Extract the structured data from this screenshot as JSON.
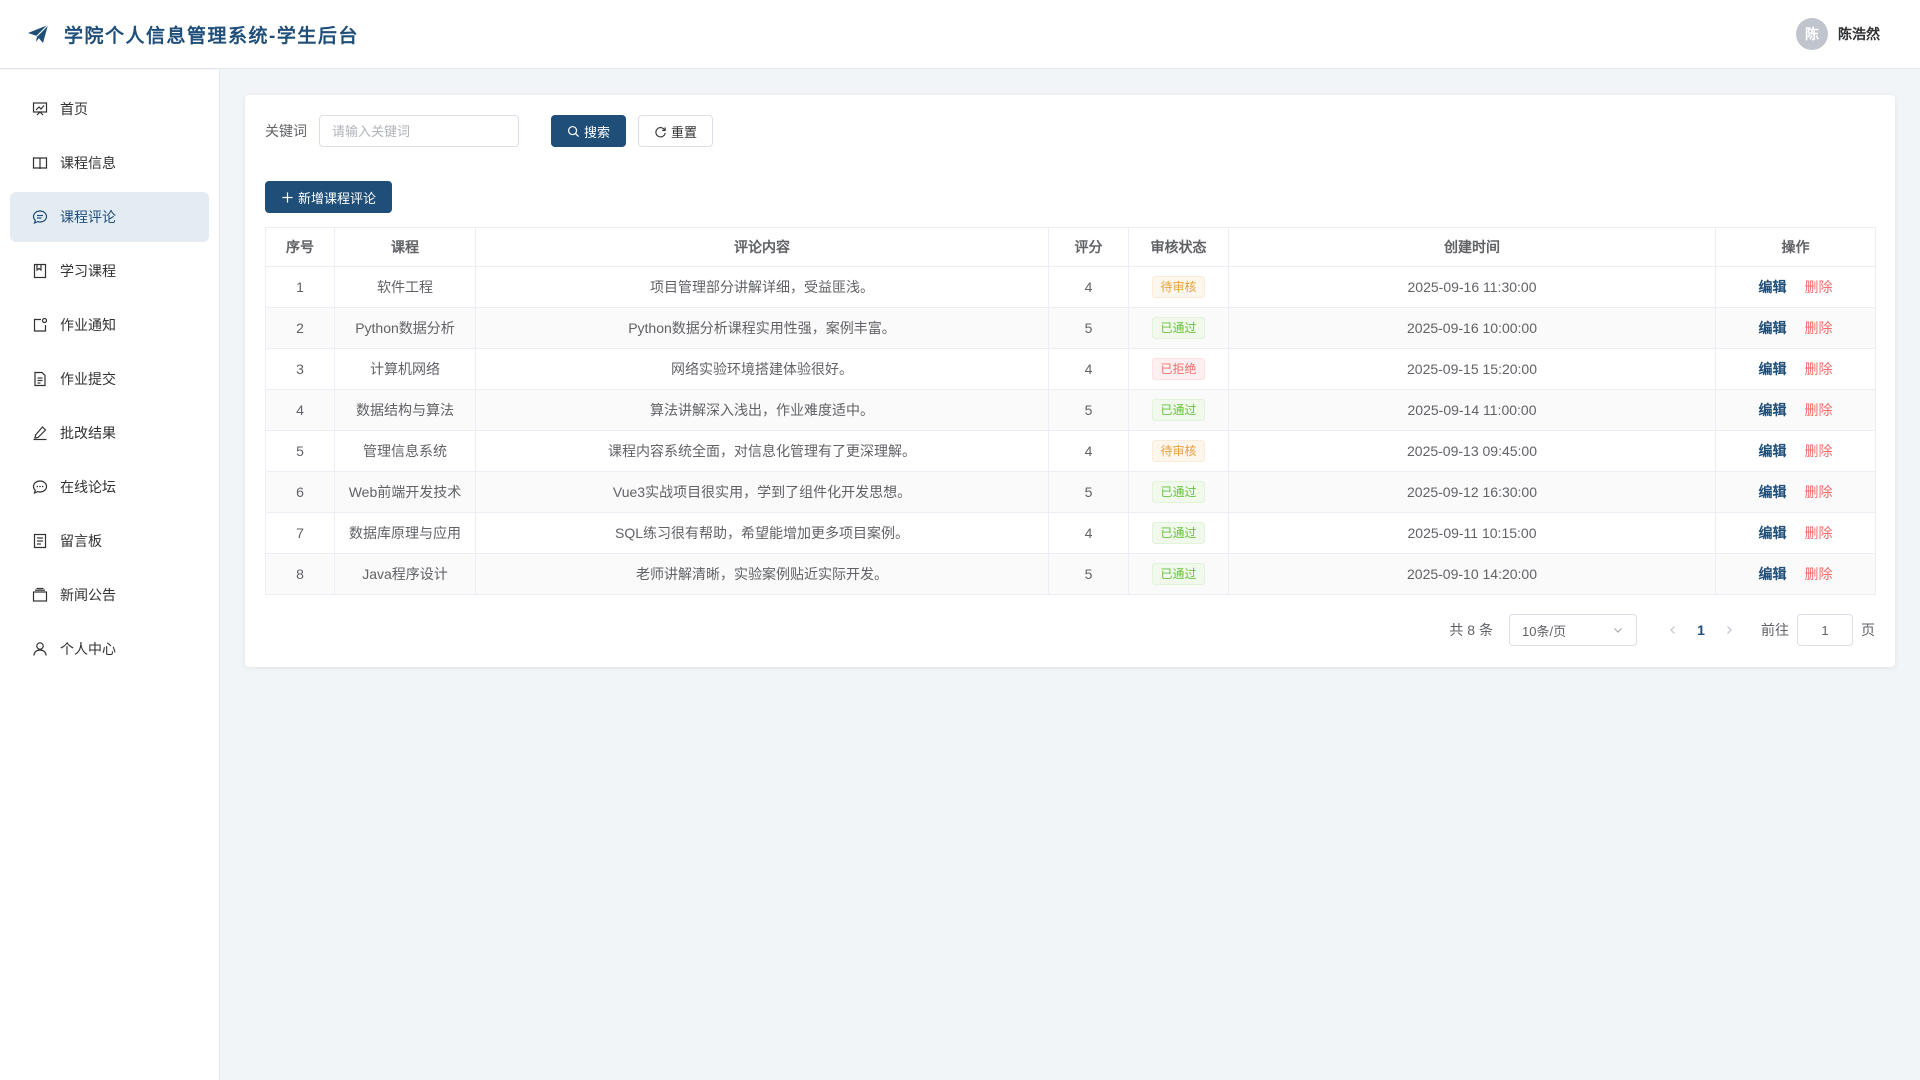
{
  "app": {
    "title": "学院个人信息管理系统-学生后台",
    "brand_color": "#1f4e79"
  },
  "user": {
    "avatar_text": "陈",
    "name": "陈浩然"
  },
  "sidebar": {
    "items": [
      {
        "label": "首页",
        "icon": "dashboard-icon"
      },
      {
        "label": "课程信息",
        "icon": "book-icon"
      },
      {
        "label": "课程评论",
        "icon": "comment-icon",
        "active": true
      },
      {
        "label": "学习课程",
        "icon": "bookmark-icon"
      },
      {
        "label": "作业通知",
        "icon": "notification-icon"
      },
      {
        "label": "作业提交",
        "icon": "document-icon"
      },
      {
        "label": "批改结果",
        "icon": "edit-pen-icon"
      },
      {
        "label": "在线论坛",
        "icon": "chat-icon"
      },
      {
        "label": "留言板",
        "icon": "tickets-icon"
      },
      {
        "label": "新闻公告",
        "icon": "news-box-icon"
      },
      {
        "label": "个人中心",
        "icon": "user-icon"
      }
    ]
  },
  "search": {
    "label": "关键词",
    "placeholder": "请输入关键词",
    "search_button": "搜索",
    "reset_button": "重置"
  },
  "toolbar": {
    "add_button": "新增课程评论"
  },
  "table": {
    "headers": [
      "序号",
      "课程",
      "评论内容",
      "评分",
      "审核状态",
      "创建时间",
      "操作"
    ],
    "rows": [
      {
        "no": "1",
        "course": "软件工程",
        "content": "项目管理部分讲解详细，受益匪浅。",
        "score": "4",
        "status": "待审核",
        "status_type": "warning",
        "time": "2025-09-16 11:30:00"
      },
      {
        "no": "2",
        "course": "Python数据分析",
        "content": "Python数据分析课程实用性强，案例丰富。",
        "score": "5",
        "status": "已通过",
        "status_type": "success",
        "time": "2025-09-16 10:00:00"
      },
      {
        "no": "3",
        "course": "计算机网络",
        "content": "网络实验环境搭建体验很好。",
        "score": "4",
        "status": "已拒绝",
        "status_type": "danger",
        "time": "2025-09-15 15:20:00"
      },
      {
        "no": "4",
        "course": "数据结构与算法",
        "content": "算法讲解深入浅出，作业难度适中。",
        "score": "5",
        "status": "已通过",
        "status_type": "success",
        "time": "2025-09-14 11:00:00"
      },
      {
        "no": "5",
        "course": "管理信息系统",
        "content": "课程内容系统全面，对信息化管理有了更深理解。",
        "score": "4",
        "status": "待审核",
        "status_type": "warning",
        "time": "2025-09-13 09:45:00"
      },
      {
        "no": "6",
        "course": "Web前端开发技术",
        "content": "Vue3实战项目很实用，学到了组件化开发思想。",
        "score": "5",
        "status": "已通过",
        "status_type": "success",
        "time": "2025-09-12 16:30:00"
      },
      {
        "no": "7",
        "course": "数据库原理与应用",
        "content": "SQL练习很有帮助，希望能增加更多项目案例。",
        "score": "4",
        "status": "已通过",
        "status_type": "success",
        "time": "2025-09-11 10:15:00"
      },
      {
        "no": "8",
        "course": "Java程序设计",
        "content": "老师讲解清晰，实验案例贴近实际开发。",
        "score": "5",
        "status": "已通过",
        "status_type": "success",
        "time": "2025-09-10 14:20:00"
      }
    ],
    "edit_label": "编辑",
    "delete_label": "删除"
  },
  "pagination": {
    "total": "共 8 条",
    "page_size": "10条/页",
    "current_page": "1",
    "goto_label": "前往",
    "goto_value": "1",
    "page_suffix": "页"
  }
}
